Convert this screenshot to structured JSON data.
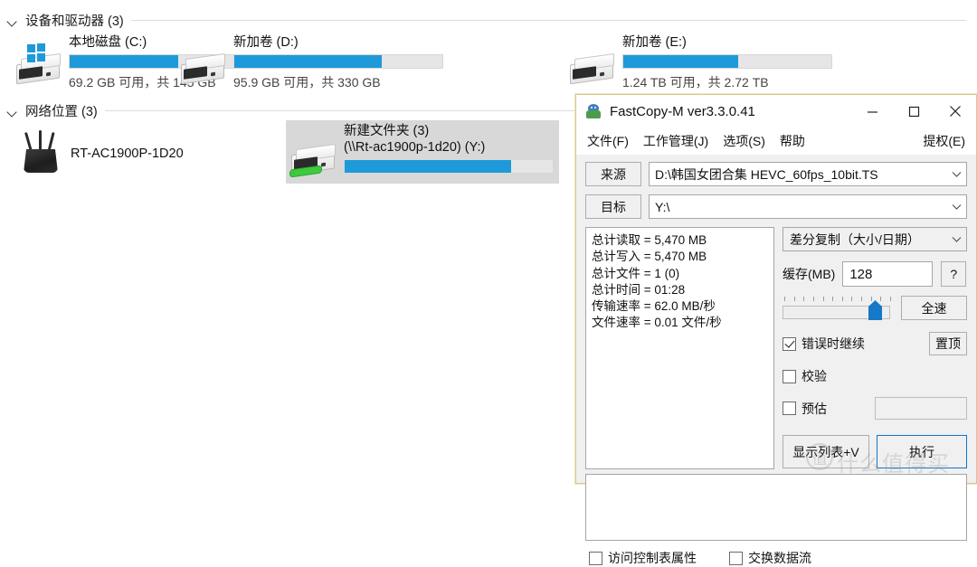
{
  "explorer": {
    "devices_section": {
      "title": "设备和驱动器 (3)",
      "chevron": "chevron-down-icon",
      "drives": [
        {
          "name": "本地磁盘 (C:)",
          "free_text": "69.2 GB 可用，共 145 GB",
          "used_percent": 52,
          "icon": "windows-drive-icon"
        },
        {
          "name": "新加卷 (D:)",
          "free_text": "95.9 GB 可用，共 330 GB",
          "used_percent": 71,
          "icon": "hard-drive-icon"
        },
        {
          "name": "新加卷 (E:)",
          "free_text": "1.24 TB 可用，共 2.72 TB",
          "used_percent": 55,
          "icon": "hard-drive-icon"
        }
      ]
    },
    "network_section": {
      "title": "网络位置 (3)",
      "chevron": "chevron-down-icon",
      "router": {
        "label": "RT-AC1900P-1D20",
        "icon": "router-icon"
      },
      "network_drive": {
        "name_line1": "新建文件夹 (3)",
        "name_line2": "(\\\\Rt-ac1900p-1d20) (Y:)",
        "used_percent": 80,
        "icon": "network-drive-icon",
        "selected": true
      }
    }
  },
  "fastcopy": {
    "title": "FastCopy-M ver3.3.0.41",
    "app_icon": "fastcopy-app-icon",
    "window_buttons": {
      "minimize": "minimize-icon",
      "maximize": "maximize-icon",
      "close": "close-icon"
    },
    "menu": {
      "items": [
        "文件(F)",
        "工作管理(J)",
        "选项(S)",
        "帮助"
      ],
      "right_item": "提权(E)"
    },
    "source": {
      "button_label": "来源",
      "value": "D:\\韩国女团合集  HEVC_60fps_10bit.TS",
      "dropdown_icon": "chevron-down-icon"
    },
    "target": {
      "button_label": "目标",
      "value": "Y:\\",
      "dropdown_icon": "chevron-down-icon"
    },
    "stats": [
      "总计读取 = 5,470 MB",
      "总计写入 = 5,470 MB",
      "总计文件 = 1 (0)",
      "总计时间 = 01:28",
      "传输速率 = 62.0 MB/秒",
      "文件速率 = 0.01 文件/秒"
    ],
    "mode": {
      "value": "差分复制（大小/日期）",
      "dropdown_icon": "chevron-down-icon"
    },
    "buffer": {
      "label": "缓存(MB)",
      "value": "128",
      "help_label": "?"
    },
    "speed": {
      "slider_position_percent": 100,
      "full_speed_label": "全速"
    },
    "options": [
      {
        "label": "错误时继续",
        "checked": true
      },
      {
        "label": "校验",
        "checked": false
      },
      {
        "label": "预估",
        "checked": false
      }
    ],
    "topmost_label": "置顶",
    "actions": {
      "list_label": "显示列表+V",
      "exec_label": "执行"
    },
    "bottom_options": [
      {
        "label": "访问控制表属性",
        "checked": false
      },
      {
        "label": "交换数据流",
        "checked": false
      }
    ]
  },
  "watermark": {
    "mark": "值",
    "text": "什么值得买"
  },
  "colors": {
    "accent_blue": "#1e9ada",
    "exec_border": "#1374c8",
    "window_border": "#d7c98a",
    "selection_gray": "#d8d8d8",
    "bar_track": "#e6e6e6"
  }
}
